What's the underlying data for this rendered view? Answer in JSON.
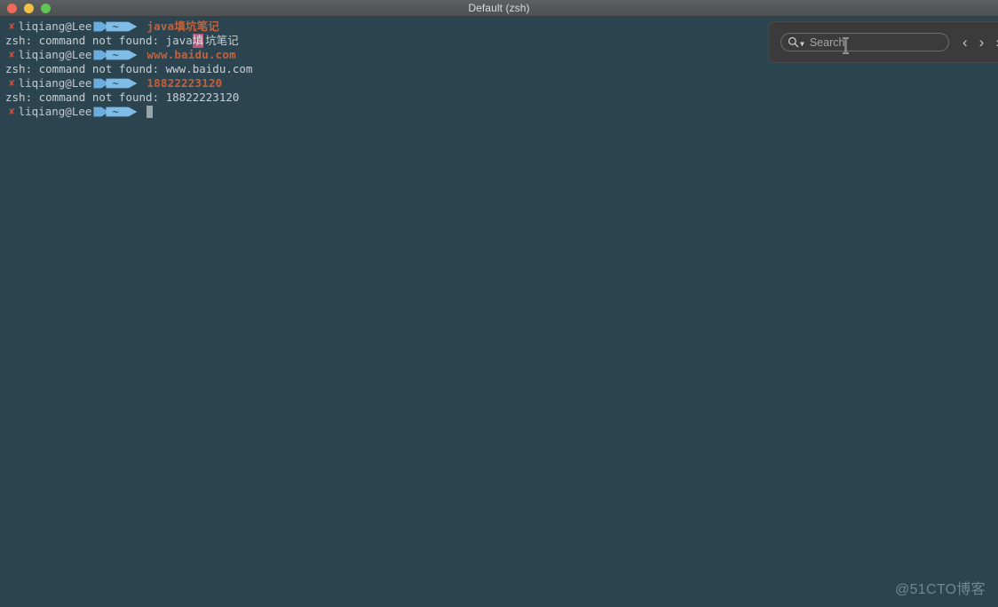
{
  "window": {
    "title": "Default (zsh)",
    "traffic_lights": [
      {
        "name": "close",
        "color": "#ef6a5c"
      },
      {
        "name": "minimize",
        "color": "#f2c046"
      },
      {
        "name": "zoom",
        "color": "#61c554"
      }
    ]
  },
  "terminal": {
    "background": "#2b4450",
    "prompt": {
      "fail_mark": "✘",
      "user_host": "liqiang@Lee",
      "path_segment": "~"
    },
    "colors": {
      "command": "#c4623b",
      "output": "#c9cfd2",
      "fail_mark": "#d34c3f",
      "segment_arrow": "#6aaee0",
      "segment_path": "#7fbde8",
      "highlight": "#b05a7e"
    },
    "lines": [
      {
        "type": "prompt",
        "command": "java填坑笔记"
      },
      {
        "type": "output",
        "pre": "zsh: command not found: java",
        "highlight": "填",
        "post": "坑笔记"
      },
      {
        "type": "prompt",
        "command": "www.baidu.com"
      },
      {
        "type": "output",
        "pre": "zsh: command not found: www.baidu.com",
        "highlight": "",
        "post": ""
      },
      {
        "type": "prompt",
        "command": "18822223120"
      },
      {
        "type": "output",
        "pre": "zsh: command not found: 18822223120",
        "highlight": "",
        "post": ""
      },
      {
        "type": "prompt_cursor",
        "command": ""
      }
    ]
  },
  "search": {
    "placeholder": "Search",
    "value": "",
    "icon": "search-icon",
    "dropdown_icon": "chevron-down-icon",
    "nav": [
      {
        "name": "previous-match",
        "glyph": "‹"
      },
      {
        "name": "next-match",
        "glyph": "›"
      },
      {
        "name": "more-matches",
        "glyph": "›"
      }
    ]
  },
  "watermark": {
    "text": "@51CTO博客"
  }
}
